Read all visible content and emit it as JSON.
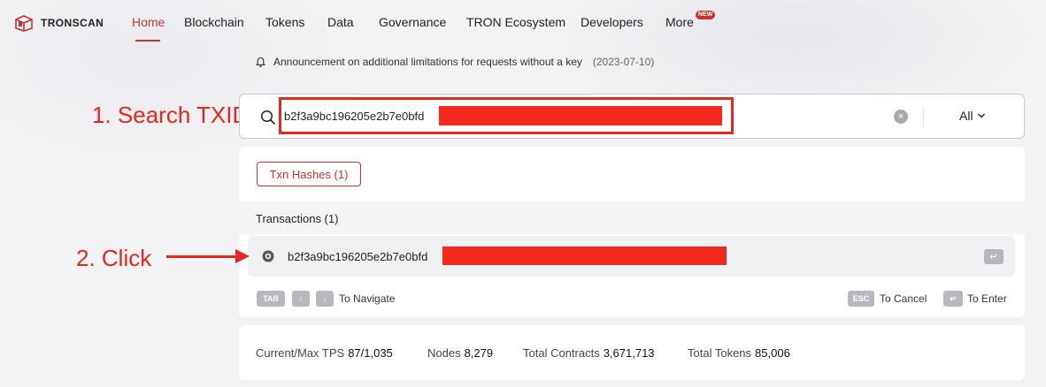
{
  "brand": {
    "name": "TRONSCAN"
  },
  "nav": {
    "items": [
      {
        "label": "Home",
        "active": true
      },
      {
        "label": "Blockchain"
      },
      {
        "label": "Tokens"
      },
      {
        "label": "Data"
      },
      {
        "label": "Governance"
      },
      {
        "label": "TRON Ecosystem"
      },
      {
        "label": "Developers"
      },
      {
        "label": "More"
      }
    ],
    "new_badge": "NEW",
    "accent_color": "#c23631"
  },
  "announcement": {
    "icon": "bell-icon",
    "text": "Announcement on additional limitations for requests without a key",
    "date": "(2023-07-10)"
  },
  "search": {
    "value": "b2f3a9bc196205e2b7e0bfd",
    "filter": "All",
    "annotation": "1. Search TXID"
  },
  "dropdown": {
    "tag": "Txn Hashes (1)",
    "section_title": "Transactions (1)",
    "result_value": "b2f3a9bc196205e2b7e0bfd",
    "annotation": "2. Click",
    "keys": {
      "tab": "TAB",
      "up": "↑",
      "down": "↓",
      "navigate_label": "To Navigate",
      "esc": "ESC",
      "cancel_label": "To Cancel",
      "enter": "↵",
      "enter_label": "To Enter"
    }
  },
  "stats": {
    "tps_label": "Current/Max TPS",
    "tps_value": "87/1,035",
    "nodes_label": "Nodes",
    "nodes_value": "8,279",
    "contracts_label": "Total Contracts",
    "contracts_value": "3,671,713",
    "tokens_label": "Total Tokens",
    "tokens_value": "85,006"
  },
  "colors": {
    "annotation": "#e3281f",
    "redaction": "#f32a1b"
  }
}
